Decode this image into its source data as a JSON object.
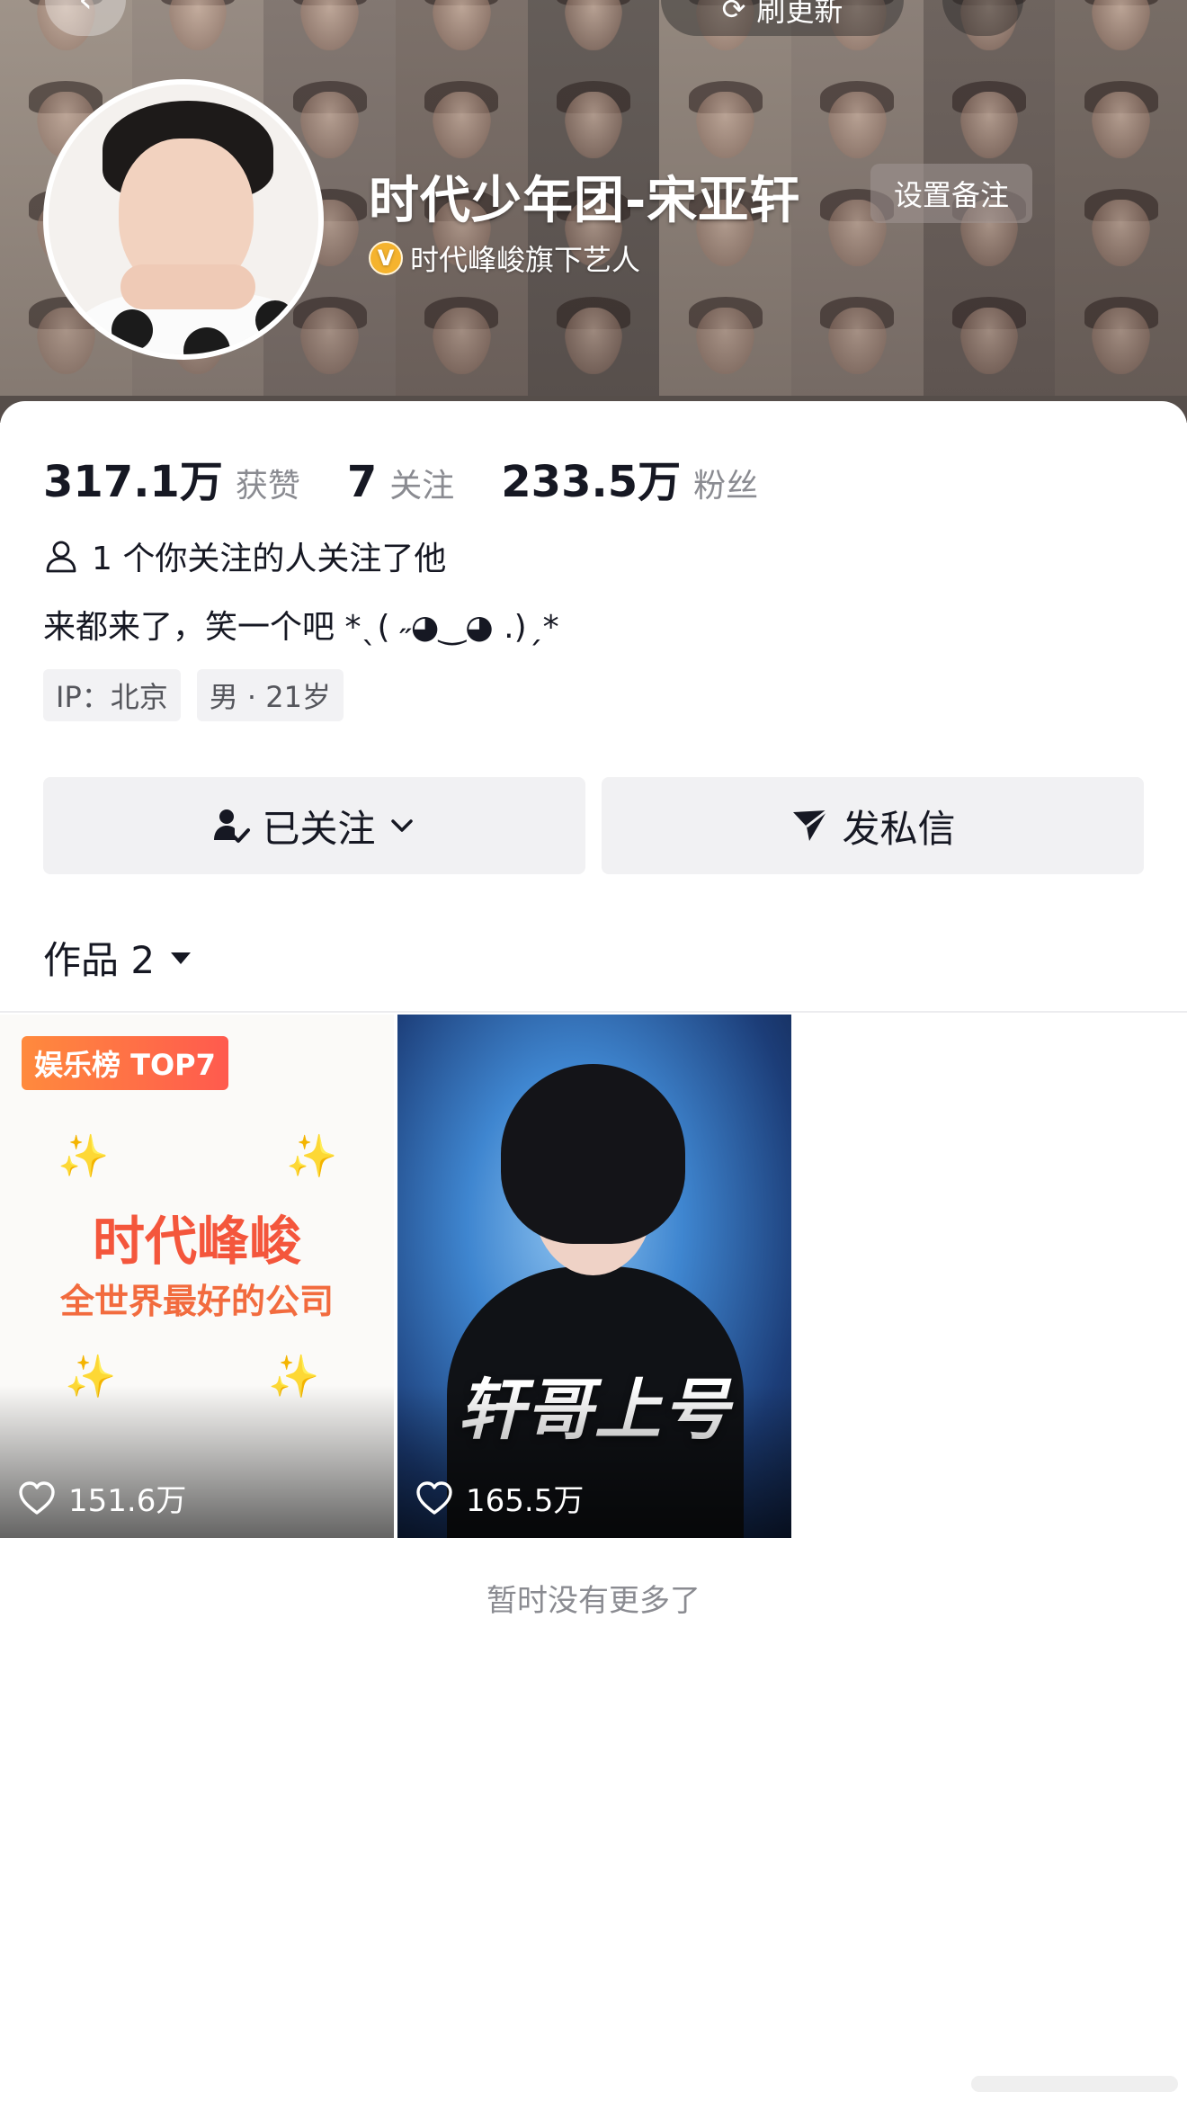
{
  "top_bar": {
    "refresh_label": "刷更新"
  },
  "profile": {
    "name": "时代少年团-宋亚轩",
    "remark_button": "设置备注",
    "verification": "时代峰峻旗下艺人",
    "verification_icon": "v-badge-icon"
  },
  "stats": {
    "likes_count": "317.1万",
    "likes_label": "获赞",
    "following_count": "7",
    "following_label": "关注",
    "followers_count": "233.5万",
    "followers_label": "粉丝"
  },
  "mutual": {
    "text": "1 个你关注的人关注了他",
    "icon": "person-icon"
  },
  "bio": "来都来了，笑一个吧 *ˎ( ˶◕‿◕ .)ˏ*",
  "tags": [
    "IP：北京",
    "男 · 21岁"
  ],
  "actions": {
    "follow_label": "已关注",
    "message_label": "发私信"
  },
  "works": {
    "tab_label": "作品 2"
  },
  "videos": [
    {
      "badge": "娱乐榜 TOP7",
      "title": "时代峰峻",
      "subtitle": "全世界最好的公司",
      "likes": "151.6万"
    },
    {
      "title": "轩哥上号",
      "likes": "165.5万"
    }
  ],
  "footer": {
    "no_more": "暂时没有更多了"
  },
  "colors": {
    "accent_orange": "#ff5a4e",
    "text_primary": "#161823",
    "text_secondary": "#8a8b91",
    "button_bg": "#f1f1f3",
    "verify_gold": "#f5b32e"
  }
}
